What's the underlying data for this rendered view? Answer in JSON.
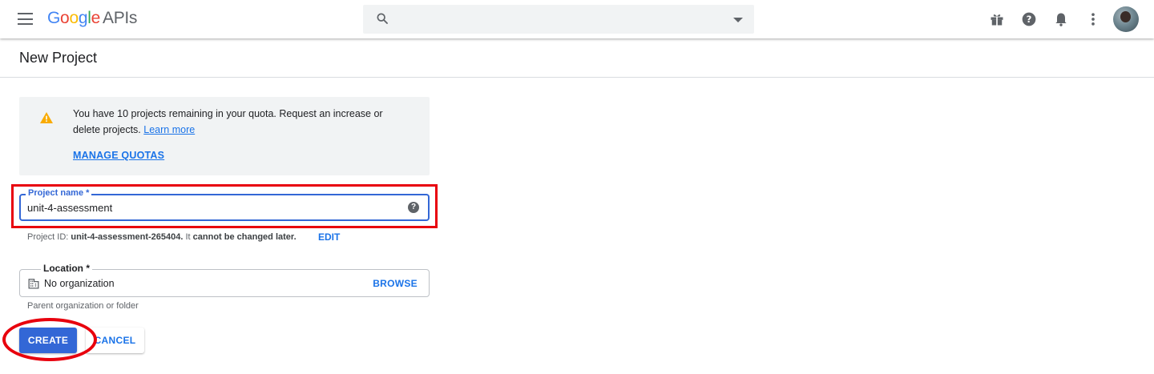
{
  "header": {
    "logo_letters": [
      {
        "ch": "G",
        "color": "#4285f4"
      },
      {
        "ch": "o",
        "color": "#ea4335"
      },
      {
        "ch": "o",
        "color": "#fbbc05"
      },
      {
        "ch": "g",
        "color": "#4285f4"
      },
      {
        "ch": "l",
        "color": "#34a853"
      },
      {
        "ch": "e",
        "color": "#ea4335"
      }
    ],
    "logo_suffix": "APIs",
    "icons": [
      "menu-icon",
      "search-icon",
      "dropdown-caret-icon",
      "gift-icon",
      "help-icon",
      "notifications-icon",
      "more-vert-icon",
      "account-avatar"
    ]
  },
  "page": {
    "title": "New Project"
  },
  "notice": {
    "message": "You have 10 projects remaining in your quota. Request an increase or delete projects.",
    "learn_more": "Learn more",
    "manage_quotas": "MANAGE QUOTAS"
  },
  "project_name": {
    "label": "Project name *",
    "value": "unit-4-assessment",
    "id_prefix": "Project ID: ",
    "id_value": "unit-4-assessment-265404.",
    "id_suffix": " It ",
    "id_cannot": "cannot be changed later.",
    "edit_label": "EDIT"
  },
  "location": {
    "label": "Location *",
    "value": "No organization",
    "browse_label": "BROWSE",
    "helper": "Parent organization or folder"
  },
  "actions": {
    "create_label": "CREATE",
    "cancel_label": "CANCEL"
  },
  "colors": {
    "accent": "#3367d6",
    "link": "#1a73e8",
    "annotation": "#e8000d",
    "warning": "#f9ab00"
  }
}
